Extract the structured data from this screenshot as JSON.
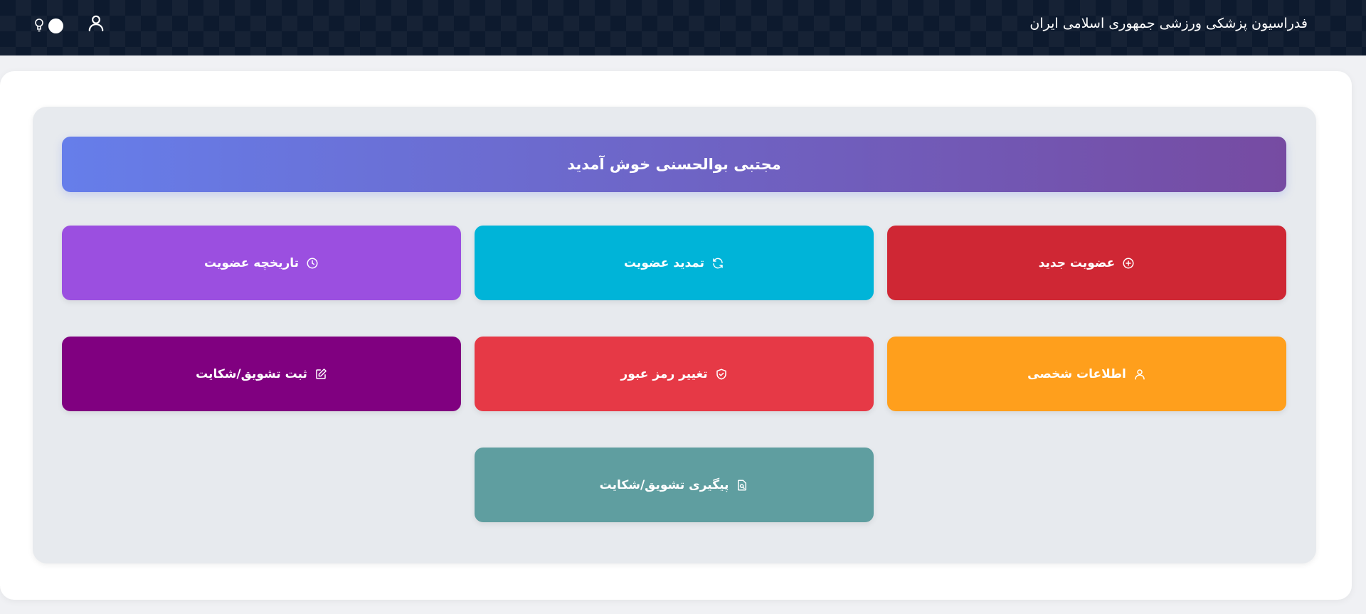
{
  "header": {
    "site_title": "فدراسیون پزشکی ورزشی جمهوری اسلامی ایران",
    "user_icon": "user-icon",
    "theme_toggle_icon": "lightbulb-icon"
  },
  "welcome": {
    "text": "مجتبی بوالحسنی خوش آمدید"
  },
  "tiles": [
    {
      "label": "عضویت جدید",
      "icon": "plus-circle-icon",
      "color": "#cf2734"
    },
    {
      "label": "تمدید عضویت",
      "icon": "refresh-icon",
      "color": "#00b4d8"
    },
    {
      "label": "تاریخچه عضویت",
      "icon": "clock-icon",
      "color": "#9b4fe0"
    },
    {
      "label": "اطلاعات شخصی",
      "icon": "user-icon",
      "color": "#ff9f1c"
    },
    {
      "label": "تغییر رمز عبور",
      "icon": "shield-icon",
      "color": "#e63946"
    },
    {
      "label": "ثبت تشویق/شکایت",
      "icon": "edit-icon",
      "color": "#800080"
    },
    {
      "label": "پیگیری تشویق/شکایت",
      "icon": "document-search-icon",
      "color": "#5f9ea0"
    }
  ],
  "colors": {
    "topbar": "#0d1a2e",
    "panel": "#e7eaee",
    "welcome_gradient_start": "#667eea",
    "welcome_gradient_end": "#764ba2"
  }
}
